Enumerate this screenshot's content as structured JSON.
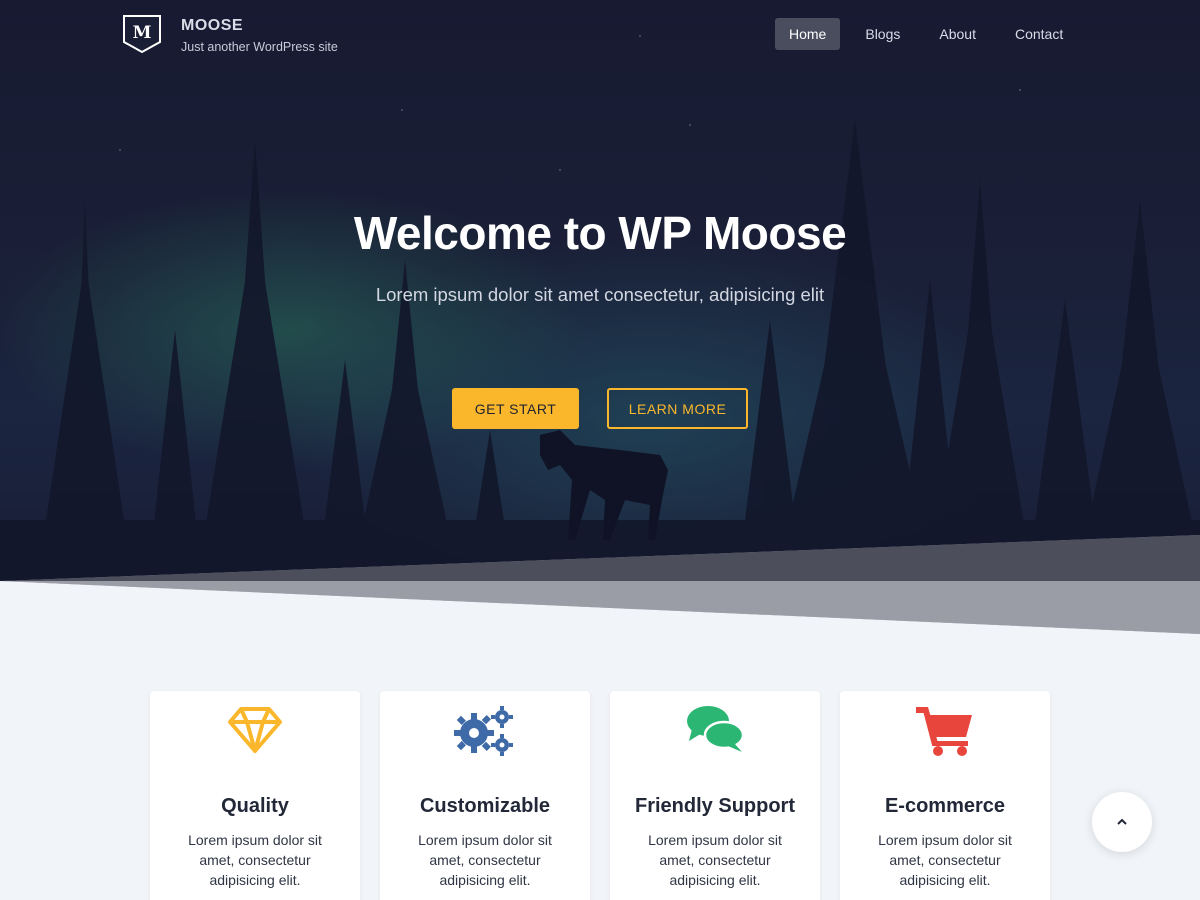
{
  "site": {
    "logo_letter": "M",
    "title": "MOOSE",
    "tagline": "Just another WordPress site"
  },
  "nav": {
    "items": [
      {
        "label": "Home",
        "active": true
      },
      {
        "label": "Blogs",
        "active": false
      },
      {
        "label": "About",
        "active": false
      },
      {
        "label": "Contact",
        "active": false
      }
    ]
  },
  "hero": {
    "title": "Welcome to WP Moose",
    "subtitle": "Lorem ipsum dolor sit amet consectetur, adipisicing elit",
    "primary_button": "GET START",
    "secondary_button": "LEARN MORE"
  },
  "features": [
    {
      "icon": "diamond-icon",
      "title": "Quality",
      "text": "Lorem ipsum dolor sit amet, consectetur adipisicing elit.",
      "color": "#fbb72c"
    },
    {
      "icon": "gears-icon",
      "title": "Customizable",
      "text": "Lorem ipsum dolor sit amet, consectetur adipisicing elit.",
      "color": "#3f6aa8"
    },
    {
      "icon": "chat-bubbles-icon",
      "title": "Friendly Support",
      "text": "Lorem ipsum dolor sit amet, consectetur adipisicing elit.",
      "color": "#2bb673"
    },
    {
      "icon": "shopping-cart-icon",
      "title": "E-commerce",
      "text": "Lorem ipsum dolor sit amet, consectetur adipisicing elit.",
      "color": "#e8453c"
    }
  ],
  "colors": {
    "accent": "#fbb72c",
    "hero_bg": "#171a31",
    "page_bg": "#f1f4f8"
  },
  "scroll_top": {
    "icon": "chevron-up-icon"
  }
}
